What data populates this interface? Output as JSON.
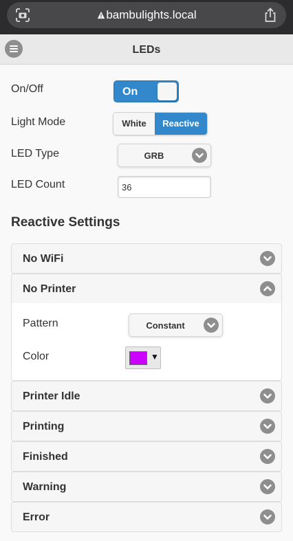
{
  "browser": {
    "url": "bambulights.local",
    "left_icon": "camera-scan-icon",
    "security_icon": "warning-triangle-icon",
    "share_icon": "share-icon"
  },
  "header": {
    "title": "LEDs",
    "menu_icon": "menu-icon"
  },
  "settings": {
    "onoff_label": "On/Off",
    "onoff_value": "On",
    "light_mode_label": "Light Mode",
    "light_mode_options": [
      "White",
      "Reactive"
    ],
    "light_mode_selected": "Reactive",
    "led_type_label": "LED Type",
    "led_type_value": "GRB",
    "led_count_label": "LED Count",
    "led_count_value": "36"
  },
  "reactive": {
    "title": "Reactive Settings",
    "sections": [
      {
        "title": "No WiFi",
        "expanded": false
      },
      {
        "title": "No Printer",
        "expanded": true
      },
      {
        "title": "Printer Idle",
        "expanded": false
      },
      {
        "title": "Printing",
        "expanded": false
      },
      {
        "title": "Finished",
        "expanded": false
      },
      {
        "title": "Warning",
        "expanded": false
      },
      {
        "title": "Error",
        "expanded": false
      }
    ],
    "no_printer": {
      "pattern_label": "Pattern",
      "pattern_value": "Constant",
      "color_label": "Color",
      "color_value": "#cc00ff",
      "color_arrow": "▼"
    }
  },
  "colors": {
    "accent": "#3388cc",
    "icon_gray": "#8e8e8e"
  }
}
